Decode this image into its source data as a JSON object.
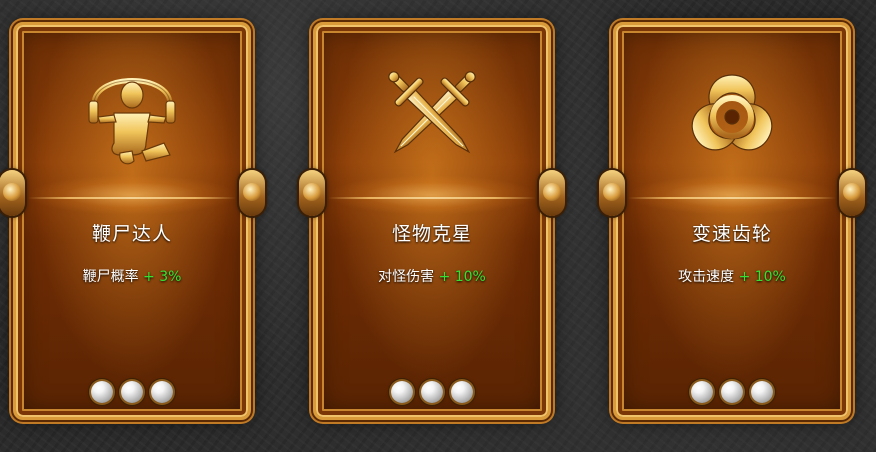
{
  "cards": [
    {
      "icon": "jump-rope-icon",
      "title": "鞭尸达人",
      "stat_label": "鞭尸概率",
      "stat_bonus": "+ 3%",
      "pips": 3
    },
    {
      "icon": "crossed-swords-icon",
      "title": "怪物克星",
      "stat_label": "对怪伤害",
      "stat_bonus": "+ 10%",
      "pips": 3
    },
    {
      "icon": "biohazard-icon",
      "title": "变速齿轮",
      "stat_label": "攻击速度",
      "stat_bonus": "+ 10%",
      "pips": 3
    }
  ],
  "colors": {
    "card_gold": "#d99a3a",
    "bonus_green": "#33e233",
    "title_white": "#ffffff"
  }
}
